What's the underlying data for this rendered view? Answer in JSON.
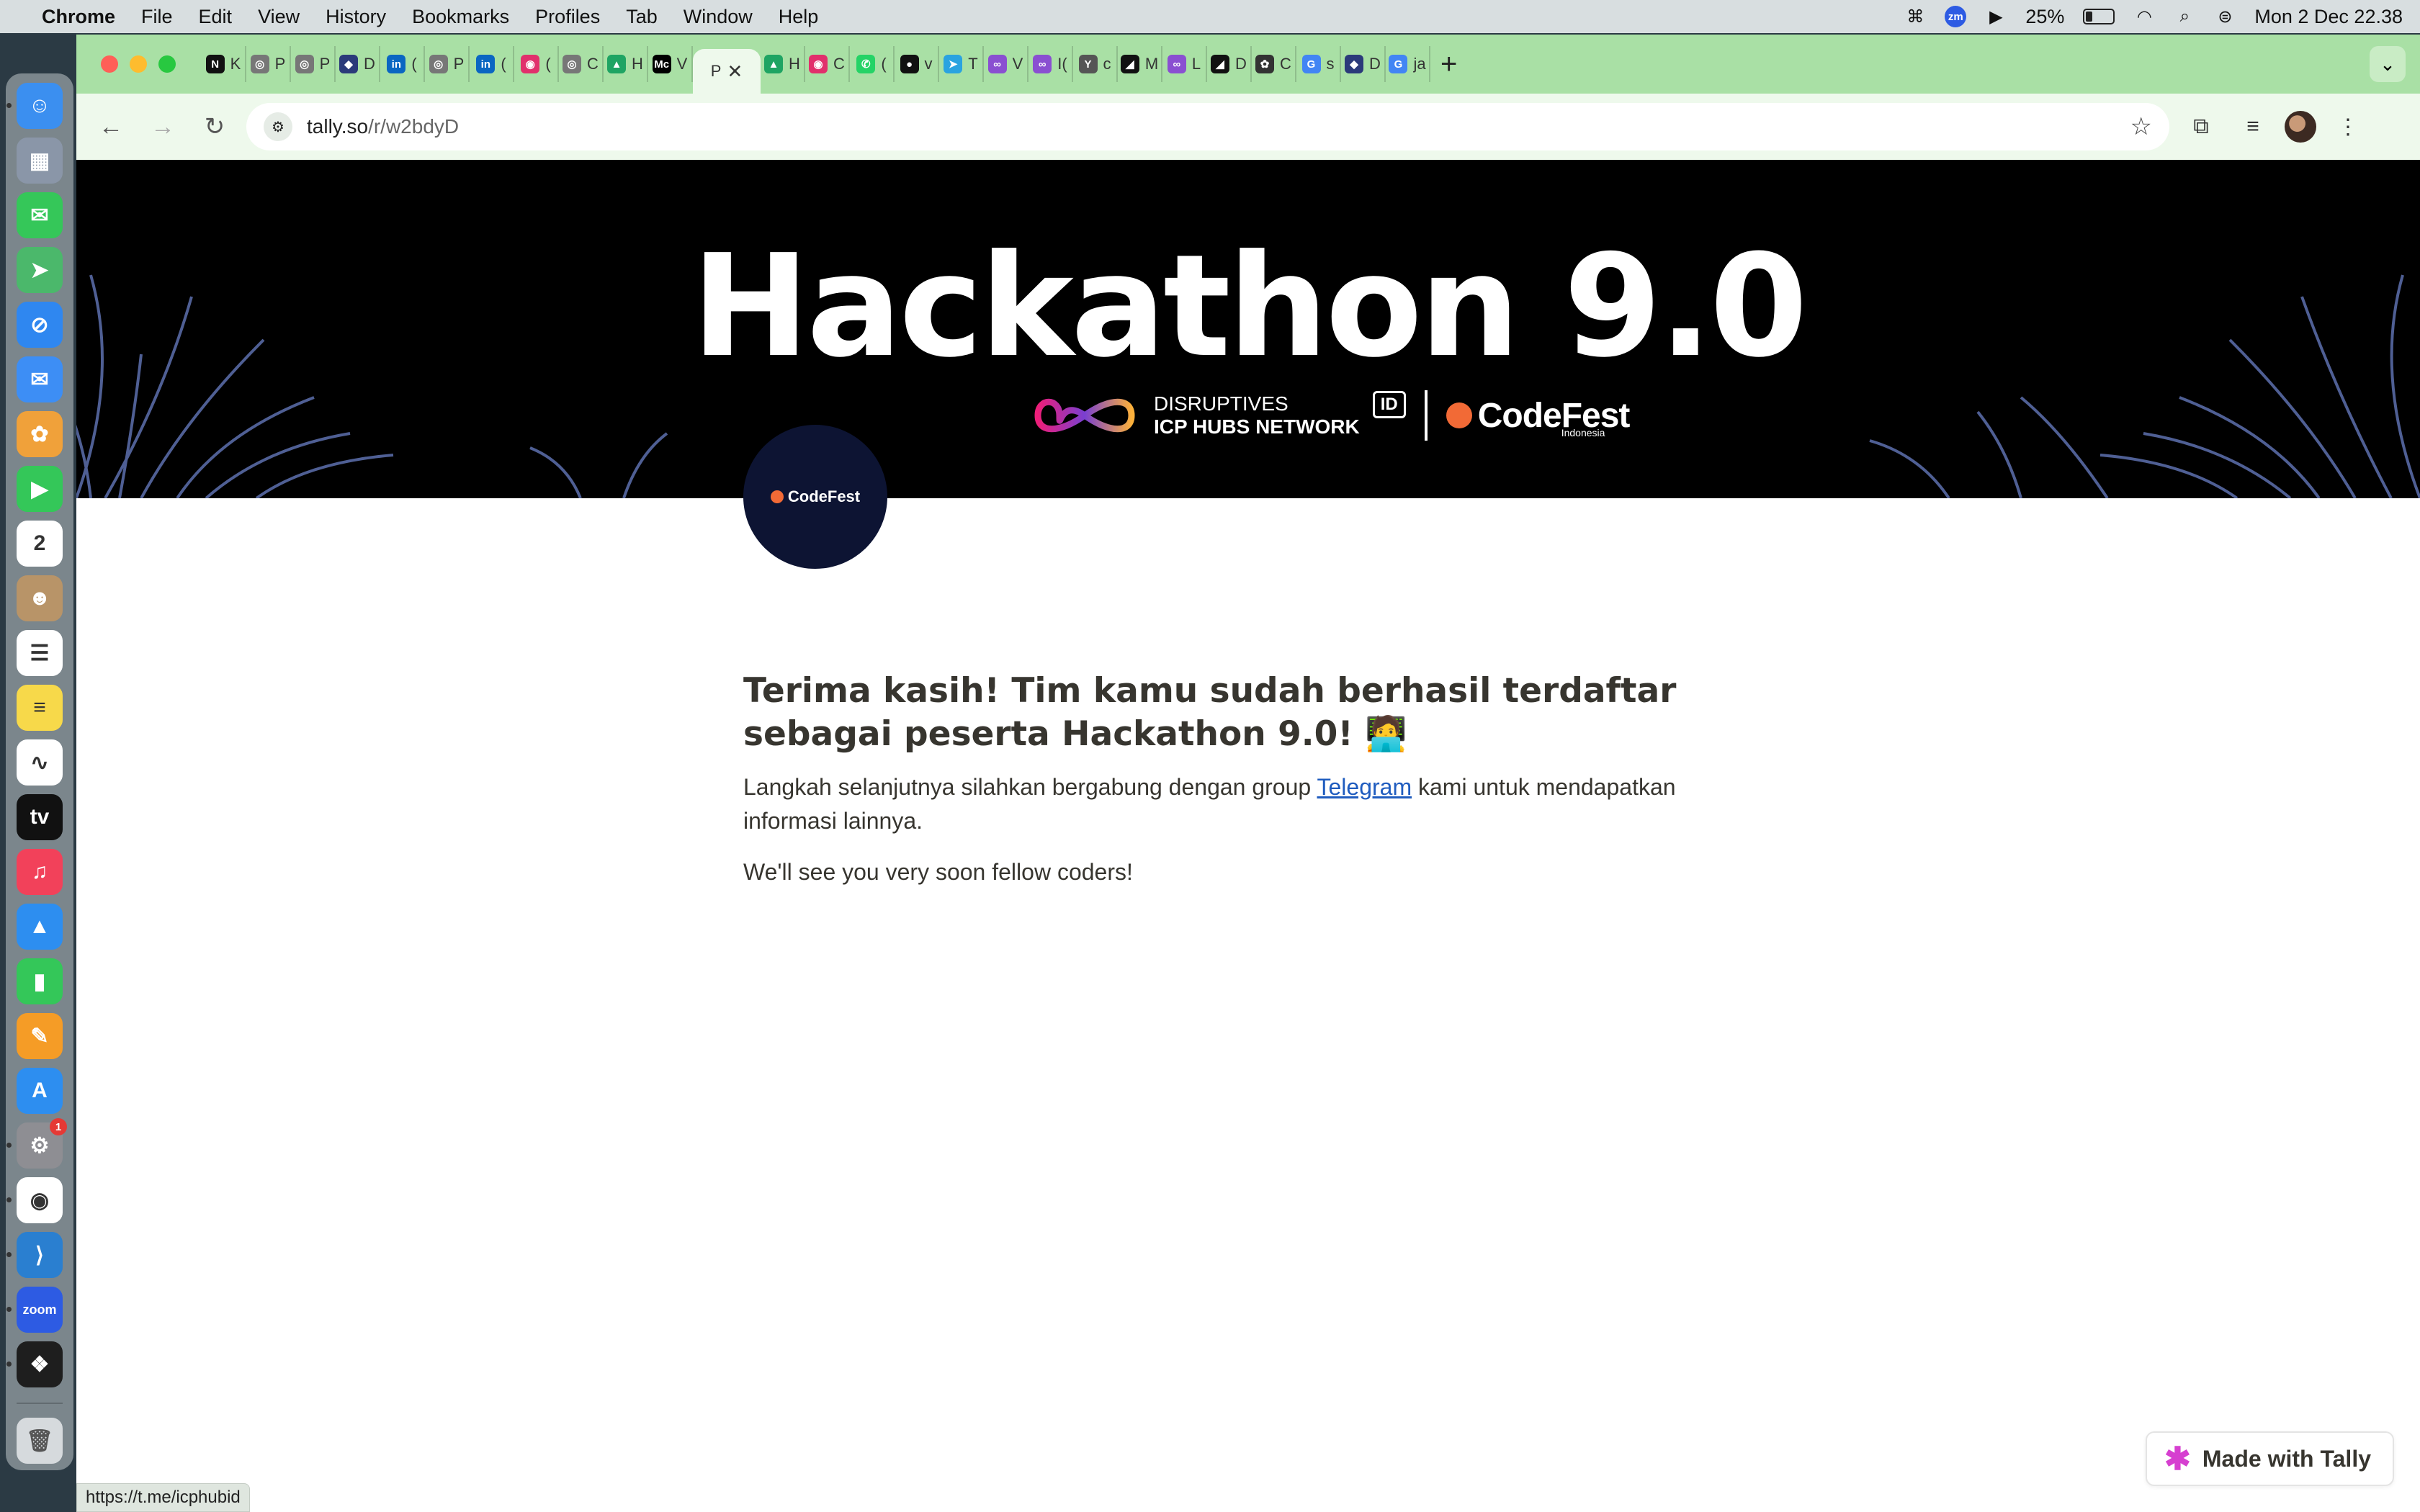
{
  "menubar": {
    "app": "Chrome",
    "items": [
      "File",
      "Edit",
      "View",
      "History",
      "Bookmarks",
      "Profiles",
      "Tab",
      "Window",
      "Help"
    ],
    "battery": "25%",
    "battery_level": 0.25,
    "datetime": "Mon 2 Dec  22.38"
  },
  "dock": {
    "apps": [
      {
        "name": "finder",
        "color": "#3b8ff0",
        "glyph": "☺"
      },
      {
        "name": "launchpad",
        "color": "#8a96a8",
        "glyph": "▦"
      },
      {
        "name": "messages",
        "color": "#35c759",
        "glyph": "✉"
      },
      {
        "name": "maps",
        "color": "#4bb86b",
        "glyph": "➤"
      },
      {
        "name": "safari",
        "color": "#2f87f0",
        "glyph": "⊘"
      },
      {
        "name": "mail",
        "color": "#3d8ef5",
        "glyph": "✉"
      },
      {
        "name": "photos",
        "color": "#f0a13a",
        "glyph": "✿"
      },
      {
        "name": "facetime",
        "color": "#34c759",
        "glyph": "▶"
      },
      {
        "name": "calendar",
        "color": "#ffffff",
        "glyph": "2"
      },
      {
        "name": "contacts",
        "color": "#b89468",
        "glyph": "☻"
      },
      {
        "name": "reminders",
        "color": "#ffffff",
        "glyph": "☰"
      },
      {
        "name": "notes",
        "color": "#f7d94a",
        "glyph": "≡"
      },
      {
        "name": "freeform",
        "color": "#ffffff",
        "glyph": "∿"
      },
      {
        "name": "apple-tv",
        "color": "#111111",
        "glyph": "tv"
      },
      {
        "name": "music",
        "color": "#f2415a",
        "glyph": "♫"
      },
      {
        "name": "keynote",
        "color": "#2d8ef0",
        "glyph": "▲"
      },
      {
        "name": "numbers",
        "color": "#34c759",
        "glyph": "▮"
      },
      {
        "name": "pages",
        "color": "#f59c26",
        "glyph": "✎"
      },
      {
        "name": "app-store",
        "color": "#2d8ef0",
        "glyph": "A"
      },
      {
        "name": "system-settings",
        "color": "#8e8e93",
        "glyph": "⚙",
        "badge": "1"
      },
      {
        "name": "chrome",
        "color": "#ffffff",
        "glyph": "◉"
      },
      {
        "name": "vscode",
        "color": "#2a7fd0",
        "glyph": "⟩"
      },
      {
        "name": "zoom",
        "color": "#2d5be3",
        "glyph": "zoom"
      },
      {
        "name": "figma",
        "color": "#1e1e1e",
        "glyph": "❖"
      }
    ],
    "trash_glyph": "🗑"
  },
  "browser": {
    "tabs": [
      {
        "fav": "N",
        "label": "K",
        "color": "#111111"
      },
      {
        "fav": "◎",
        "label": "P",
        "color": "#777777"
      },
      {
        "fav": "◎",
        "label": "P",
        "color": "#777777"
      },
      {
        "fav": "◆",
        "label": "D",
        "color": "#2b3a7a"
      },
      {
        "fav": "in",
        "label": "(",
        "color": "#0a66c2"
      },
      {
        "fav": "◎",
        "label": "P",
        "color": "#777777"
      },
      {
        "fav": "in",
        "label": "(",
        "color": "#0a66c2"
      },
      {
        "fav": "◉",
        "label": "(",
        "color": "#e1306c"
      },
      {
        "fav": "◎",
        "label": "C",
        "color": "#777777"
      },
      {
        "fav": "▲",
        "label": "H",
        "color": "#1fa463"
      },
      {
        "fav": "Mc",
        "label": "V",
        "color": "#000000"
      },
      {
        "fav": "",
        "label": "P",
        "color": "#eef9ec",
        "active": true
      },
      {
        "fav": "▲",
        "label": "H",
        "color": "#1fa463"
      },
      {
        "fav": "◉",
        "label": "C",
        "color": "#e1306c"
      },
      {
        "fav": "✆",
        "label": "(",
        "color": "#25d366"
      },
      {
        "fav": "●",
        "label": "v",
        "color": "#111111"
      },
      {
        "fav": "➤",
        "label": "T",
        "color": "#2aa3e0"
      },
      {
        "fav": "∞",
        "label": "V",
        "color": "#8a4fd1"
      },
      {
        "fav": "∞",
        "label": "I(",
        "color": "#8a4fd1"
      },
      {
        "fav": "Y",
        "label": "c",
        "color": "#555555"
      },
      {
        "fav": "◢",
        "label": "M",
        "color": "#111111"
      },
      {
        "fav": "∞",
        "label": "L",
        "color": "#8a4fd1"
      },
      {
        "fav": "◢",
        "label": "D",
        "color": "#111111"
      },
      {
        "fav": "✿",
        "label": "C",
        "color": "#333333"
      },
      {
        "fav": "G",
        "label": "s",
        "color": "#4285f4"
      },
      {
        "fav": "◆",
        "label": "D",
        "color": "#2b3a7a"
      },
      {
        "fav": "G",
        "label": "ja",
        "color": "#4285f4"
      }
    ],
    "url_host": "tally.so",
    "url_path": "/r/w2bdyD"
  },
  "page": {
    "banner_title": "Hackathon 9.0",
    "logos": {
      "disruptives": "DISRUPTIVES",
      "icp": "ICP HUBS NETWORK",
      "id": "ID",
      "codefest": "CodeFest",
      "codefest_sub": "Indonesia"
    },
    "profile_label": "CodeFest",
    "heading": "Terima kasih! Tim kamu sudah berhasil terdaftar sebagai peserta Hackathon 9.0! 🧑‍💻",
    "para_before": "Langkah selanjutnya silahkan bergabung dengan group ",
    "para_link": "Telegram",
    "para_after": " kami untuk mendapatkan informasi lainnya.",
    "para2": "We'll see you very soon fellow coders!",
    "made_with": "Made with Tally",
    "status_url": "https://t.me/icphubid"
  }
}
